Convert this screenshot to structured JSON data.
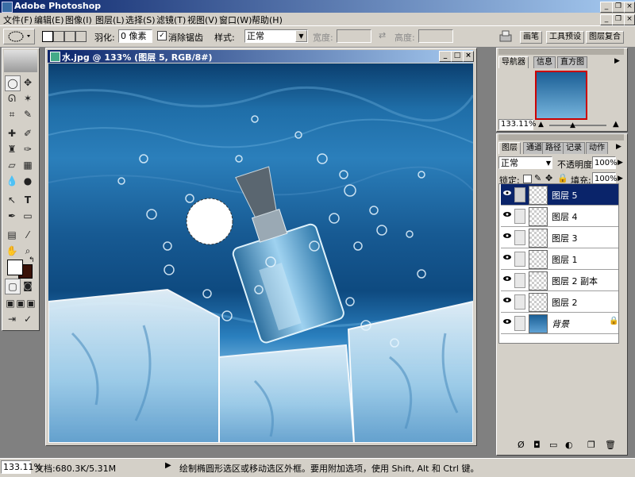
{
  "app": {
    "title": "Adobe Photoshop"
  },
  "menu": [
    "文件(F)",
    "编辑(E)",
    "图像(I)",
    "图层(L)",
    "选择(S)",
    "滤镜(T)",
    "视图(V)",
    "窗口(W)",
    "帮助(H)"
  ],
  "options": {
    "feather_label": "羽化:",
    "feather_value": "0 像素",
    "antialias_label": "消除锯齿",
    "style_label": "样式:",
    "style_value": "正常",
    "width_label": "宽度:",
    "height_label": "高度:",
    "well_tabs": [
      "画笔",
      "工具预设",
      "图层复合"
    ]
  },
  "document": {
    "title": "水.jpg @ 133% (图层 5, RGB/8#)"
  },
  "navigator": {
    "tabs": [
      "导航器",
      "信息",
      "直方图"
    ],
    "zoom": "133.11%"
  },
  "layers": {
    "tabs": [
      "图层",
      "通道",
      "路径",
      "记录",
      "动作"
    ],
    "blend_mode": "正常",
    "opacity_label": "不透明度:",
    "opacity_value": "100%",
    "lock_label": "锁定:",
    "fill_label": "填充:",
    "fill_value": "100%",
    "items": [
      {
        "name": "图层 5",
        "selected": true
      },
      {
        "name": "图层 4",
        "selected": false
      },
      {
        "name": "图层 3",
        "selected": false
      },
      {
        "name": "图层 1",
        "selected": false
      },
      {
        "name": "图层 2 副本",
        "selected": false
      },
      {
        "name": "图层 2",
        "selected": false
      },
      {
        "name": "背景",
        "selected": false
      }
    ]
  },
  "status": {
    "zoom": "133.11%",
    "doc_size": "文档:680.3K/5.31M",
    "hint": "绘制椭圆形选区或移动选区外框。要用附加选项，使用 Shift, Alt 和 Ctrl 键。"
  },
  "colors": {
    "titlebar": "#0a246a",
    "panel": "#d4d0c8",
    "selected_layer": "#0a246a"
  }
}
